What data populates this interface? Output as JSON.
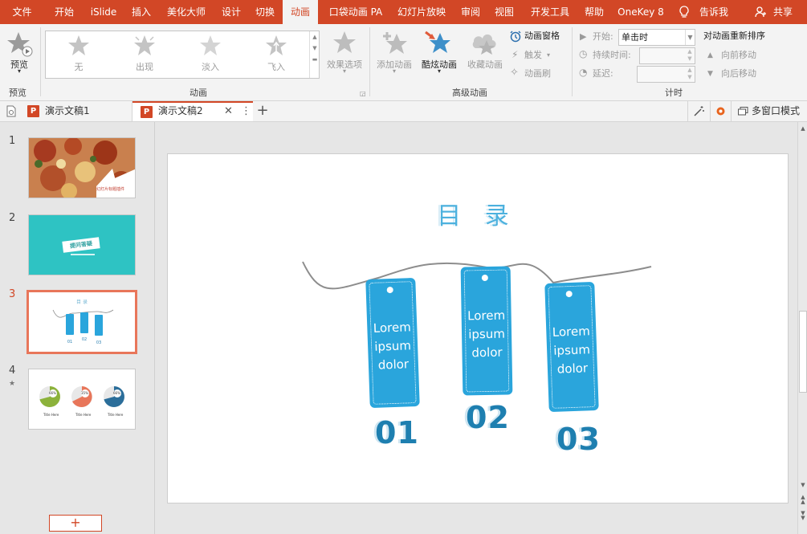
{
  "menu_tabs": [
    {
      "label": "文件"
    },
    {
      "label": "开始"
    },
    {
      "label": "iSlide"
    },
    {
      "label": "插入"
    },
    {
      "label": "美化大师"
    },
    {
      "label": "设计"
    },
    {
      "label": "切换"
    },
    {
      "label": "动画"
    },
    {
      "label": "口袋动画 PA"
    },
    {
      "label": "幻灯片放映"
    },
    {
      "label": "审阅"
    },
    {
      "label": "视图"
    },
    {
      "label": "开发工具"
    },
    {
      "label": "帮助"
    },
    {
      "label": "OneKey 8"
    }
  ],
  "tell_me": "告诉我",
  "share": "共享",
  "ribbon": {
    "preview": {
      "label": "预览",
      "group": "预览"
    },
    "animations": {
      "group": "动画",
      "items": [
        {
          "label": "无"
        },
        {
          "label": "出现"
        },
        {
          "label": "淡入"
        },
        {
          "label": "飞入"
        }
      ],
      "effect_options": "效果选项"
    },
    "advanced": {
      "group": "高级动画",
      "add": "添加动画",
      "cool": "酷炫动画",
      "favorite": "收藏动画",
      "pane": "动画窗格",
      "trigger": "触发",
      "painter": "动画刷"
    },
    "timing": {
      "group": "计时",
      "start_label": "开始:",
      "start_value": "单击时",
      "duration_label": "持续时间:",
      "delay_label": "延迟:"
    },
    "reorder": {
      "title": "对动画重新排序",
      "earlier": "向前移动",
      "later": "向后移动"
    }
  },
  "doc_tabs": [
    {
      "label": "演示文稿1"
    },
    {
      "label": "演示文稿2"
    }
  ],
  "multi_window": "多窗口模式",
  "slides": [
    {
      "num": "1",
      "caption": "幻灯片标题插件"
    },
    {
      "num": "2",
      "caption": "提问答疑"
    },
    {
      "num": "3"
    },
    {
      "num": "4",
      "pcts": [
        "66%",
        "35%",
        "66%"
      ],
      "subs": [
        "Title Here",
        "Title Here",
        "Title Here"
      ]
    }
  ],
  "current_slide": {
    "title": "目 录",
    "tags": [
      {
        "text1": "Lorem",
        "text2": "ipsum",
        "text3": "dolor",
        "num": "01"
      },
      {
        "text1": "Lorem",
        "text2": "ipsum",
        "text3": "dolor",
        "num": "02"
      },
      {
        "text1": "Lorem",
        "text2": "ipsum",
        "text3": "dolor",
        "num": "03"
      }
    ]
  },
  "colors": {
    "accent": "#d24726",
    "tag_blue": "#2aa5dc",
    "num_blue": "#1e7fb0",
    "title_blue": "#4cb1de"
  }
}
